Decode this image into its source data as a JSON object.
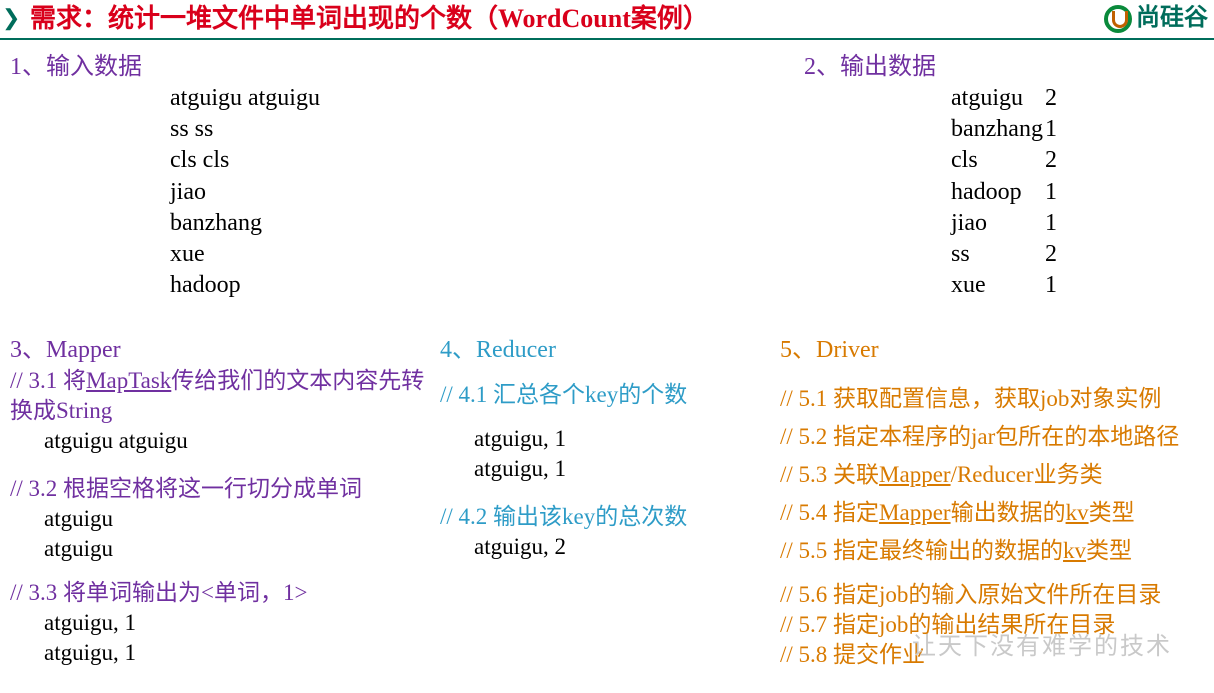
{
  "header": {
    "title": "需求：统计一堆文件中单词出现的个数（WordCount案例）",
    "brand": "尚硅谷"
  },
  "input": {
    "heading": "1、输入数据",
    "lines": [
      "atguigu atguigu",
      "ss ss",
      "cls cls",
      "jiao",
      "banzhang",
      "xue",
      "hadoop"
    ]
  },
  "output": {
    "heading": "2、输出数据",
    "rows": [
      {
        "k": "atguigu",
        "v": "2"
      },
      {
        "k": "banzhang",
        "v": "1"
      },
      {
        "k": "cls",
        "v": "2"
      },
      {
        "k": "hadoop",
        "v": "1"
      },
      {
        "k": "jiao",
        "v": "1"
      },
      {
        "k": "ss",
        "v": "2"
      },
      {
        "k": "xue",
        "v": "1"
      }
    ]
  },
  "mapper": {
    "heading": "3、Mapper",
    "s31a": "//  3.1 将",
    "s31u": "MapTask",
    "s31b": "传给我们的文本内容先转换成String",
    "d31": "atguigu atguigu",
    "s32": "// 3.2 根据空格将这一行切分成单词",
    "d32a": "atguigu",
    "d32b": "atguigu",
    "s33": "// 3.3 将单词输出为<单词，1>",
    "d33a": "atguigu, 1",
    "d33b": "atguigu, 1"
  },
  "reducer": {
    "heading": "4、Reducer",
    "s41": "// 4.1 汇总各个key的个数",
    "d41a": "atguigu, 1",
    "d41b": "atguigu, 1",
    "s42": "// 4.2  输出该key的总次数",
    "d42": "atguigu, 2"
  },
  "driver": {
    "heading": "5、Driver",
    "s51": "// 5.1 获取配置信息，获取job对象实例",
    "s52": "// 5.2 指定本程序的jar包所在的本地路径",
    "s53a": "// 5.3 关联",
    "s53u": "Mapper",
    "s53b": "/Reducer业务类",
    "s54a": "// 5.4 指定",
    "s54u1": "Mapper",
    "s54b": "输出数据的",
    "s54u2": "kv",
    "s54c": "类型",
    "s55a": "// 5.5 指定最终输出的数据的",
    "s55u": "kv",
    "s55b": "类型",
    "s56": "// 5.6 指定job的输入原始文件所在目录",
    "s57": "// 5.7  指定job的输出结果所在目录",
    "s58": "// 5.8 提交作业"
  },
  "footer": "让天下没有难学的技术"
}
